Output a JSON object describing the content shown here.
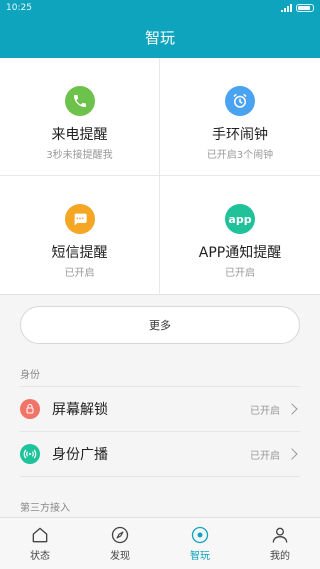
{
  "status_bar": {
    "time": "10:25"
  },
  "app_bar": {
    "title": "智玩"
  },
  "colors": {
    "accent": "#0ea4bd",
    "call": "#6cc24a",
    "alarm": "#4aa3f0",
    "sms": "#f5a623",
    "app": "#21c29a",
    "lock": "#f07467",
    "broadcast": "#1fc39b"
  },
  "tiles": [
    {
      "title": "来电提醒",
      "sub": "3秒未接提醒我",
      "icon": "phone-icon"
    },
    {
      "title": "手环闹钟",
      "sub": "已开启3个闹钟",
      "icon": "alarm-clock-icon"
    },
    {
      "title": "短信提醒",
      "sub": "已开启",
      "icon": "message-icon"
    },
    {
      "title": "APP通知提醒",
      "sub": "已开启",
      "icon": "app-icon",
      "glyph": "app"
    }
  ],
  "more_button": "更多",
  "identity": {
    "label": "身份",
    "items": [
      {
        "label": "屏幕解锁",
        "status": "已开启",
        "icon": "lock-icon"
      },
      {
        "label": "身份广播",
        "status": "已开启",
        "icon": "broadcast-icon"
      }
    ]
  },
  "third_party": {
    "label": "第三方接入"
  },
  "nav": [
    {
      "label": "状态",
      "icon": "home-icon"
    },
    {
      "label": "发现",
      "icon": "compass-icon"
    },
    {
      "label": "智玩",
      "icon": "smart-play-icon",
      "active": true
    },
    {
      "label": "我的",
      "icon": "person-icon"
    }
  ]
}
